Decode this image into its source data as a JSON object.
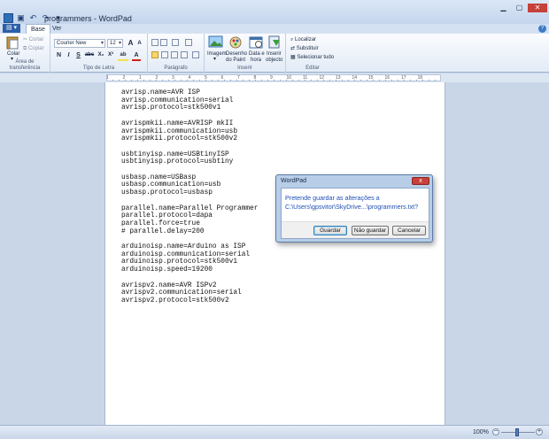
{
  "window": {
    "title": "programmers - WordPad",
    "quick_access_arrow": "▾"
  },
  "ribbon": {
    "tabs": [
      {
        "label": "Base",
        "active": true
      },
      {
        "label": "Ver",
        "active": false
      }
    ],
    "clipboard": {
      "paste_label": "Colar",
      "cut_label": "Cortar",
      "copy_label": "Copiar",
      "group_label": "Área de transferência"
    },
    "font": {
      "family": "Courier New",
      "size": "12",
      "bold": "N",
      "italic": "I",
      "underline": "S",
      "strike": "abc",
      "subscript": "X₂",
      "superscript": "X²",
      "grow": "A",
      "shrink": "A",
      "highlight": "ab",
      "color": "A",
      "group_label": "Tipo de Letra"
    },
    "paragraph": {
      "group_label": "Parágrafo"
    },
    "insert": {
      "image_label": "Imagem",
      "paint_label_1": "Desenho",
      "paint_label_2": "do Paint",
      "datetime_label_1": "Data e",
      "datetime_label_2": "hora",
      "object_label_1": "Inserir",
      "object_label_2": "objecto",
      "group_label": "Inserir"
    },
    "editing": {
      "find_label": "Localizar",
      "replace_label": "Substituir",
      "select_all_label": "Selecionar tudo",
      "group_label": "Editar"
    },
    "colors": {
      "tab_active": "#2b5fa8",
      "close_red": "#c7403a"
    }
  },
  "ruler": {
    "labels": [
      "1",
      "2",
      "1",
      "2",
      "3",
      "4",
      "5",
      "6",
      "7",
      "8",
      "9",
      "10",
      "11",
      "12",
      "13",
      "14",
      "15",
      "16",
      "17",
      "18"
    ]
  },
  "document": {
    "lines": [
      "avrisp.name=AVR ISP",
      "avrisp.communication=serial",
      "avrisp.protocol=stk500v1",
      "",
      "avrispmkii.name=AVRISP mkII",
      "avrispmkii.communication=usb",
      "avrispmkii.protocol=stk500v2",
      "",
      "usbtinyisp.name=USBtinyISP",
      "usbtinyisp.protocol=usbtiny",
      "",
      "usbasp.name=USBasp",
      "usbasp.communication=usb",
      "usbasp.protocol=usbasp",
      "",
      "parallel.name=Parallel Programmer",
      "parallel.protocol=dapa",
      "parallel.force=true",
      "# parallel.delay=200",
      "",
      "arduinoisp.name=Arduino as ISP",
      "arduinoisp.communication=serial",
      "arduinoisp.protocol=stk500v1",
      "arduinoisp.speed=19200",
      "",
      "avrispv2.name=AVR ISPv2",
      "avrispv2.communication=serial",
      "avrispv2.protocol=stk500v2"
    ]
  },
  "status": {
    "zoom": "100%",
    "zoom_minus": "−",
    "zoom_plus": "+"
  },
  "dialog": {
    "title": "WordPad",
    "close_glyph": "x",
    "message_line1": "Pretende guardar as alterações a",
    "message_line2": "C:\\Users\\gpsvitor\\SkyDrive...\\programmers.txt?",
    "buttons": {
      "save": "Guardar",
      "dont_save": "Não guardar",
      "cancel": "Cancelar"
    }
  }
}
